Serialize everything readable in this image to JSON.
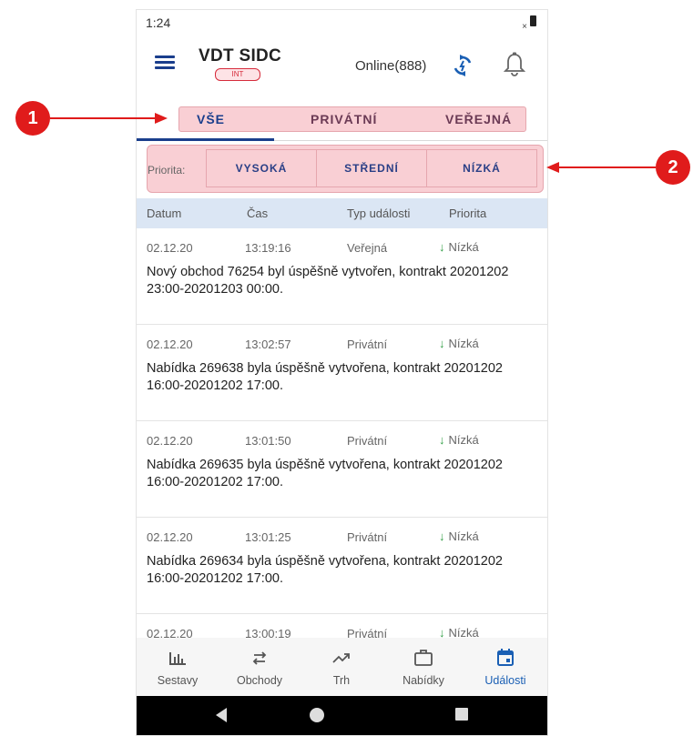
{
  "status": {
    "time": "1:24",
    "signal": "×"
  },
  "header": {
    "title": "VDT SIDC",
    "env_badge": "INT",
    "online": "Online(888)"
  },
  "tabs": [
    {
      "label": "VŠE",
      "active": true
    },
    {
      "label": "PRIVÁTNÍ",
      "active": false
    },
    {
      "label": "VEŘEJNÁ",
      "active": false
    }
  ],
  "priority": {
    "label": "Priorita:",
    "options": [
      "VYSOKÁ",
      "STŘEDNÍ",
      "NÍZKÁ"
    ]
  },
  "table": {
    "headers": [
      "Datum",
      "Čas",
      "Typ události",
      "Priorita"
    ]
  },
  "events": [
    {
      "date": "02.12.20",
      "time": "13:19:16",
      "type": "Veřejná",
      "priority": "Nízká",
      "message": "Nový obchod 76254 byl úspěšně vytvořen, kontrakt 20201202 23:00-20201203 00:00."
    },
    {
      "date": "02.12.20",
      "time": "13:02:57",
      "type": "Privátní",
      "priority": "Nízká",
      "message": "Nabídka 269638 byla úspěšně vytvořena, kontrakt 20201202 16:00-20201202 17:00."
    },
    {
      "date": "02.12.20",
      "time": "13:01:50",
      "type": "Privátní",
      "priority": "Nízká",
      "message": "Nabídka 269635 byla úspěšně vytvořena, kontrakt 20201202 16:00-20201202 17:00."
    },
    {
      "date": "02.12.20",
      "time": "13:01:25",
      "type": "Privátní",
      "priority": "Nízká",
      "message": "Nabídka 269634 byla úspěšně vytvořena, kontrakt 20201202 16:00-20201202 17:00."
    },
    {
      "date": "02.12.20",
      "time": "13:00:19",
      "type": "Privátní",
      "priority": "Nízká",
      "message": ""
    }
  ],
  "bottom_nav": [
    {
      "label": "Sestavy",
      "icon": "bar-chart-icon",
      "active": false
    },
    {
      "label": "Obchody",
      "icon": "swap-arrows-icon",
      "active": false
    },
    {
      "label": "Trh",
      "icon": "trending-up-icon",
      "active": false
    },
    {
      "label": "Nabídky",
      "icon": "briefcase-icon",
      "active": false
    },
    {
      "label": "Události",
      "icon": "calendar-icon",
      "active": true
    }
  ],
  "callouts": [
    "1",
    "2"
  ],
  "colors": {
    "primary": "#1a3e8c",
    "highlight": "#f9cfd4",
    "callout": "#e01b1b",
    "low_priority": "#2f9e44"
  }
}
